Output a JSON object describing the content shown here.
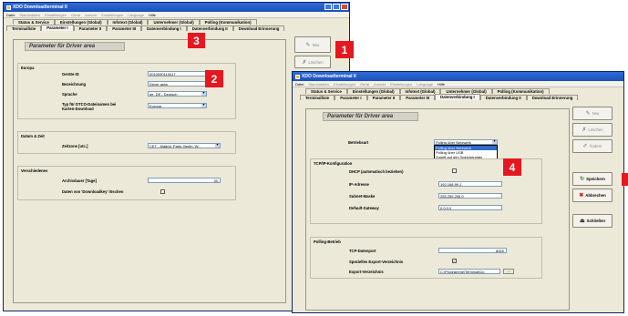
{
  "back_window": {
    "title": "XDO Downloadterminal II",
    "menu": [
      "Datei",
      "Stammdaten",
      "Einstellungen",
      "Gerät",
      "Ansicht",
      "Einstellungen",
      "Language",
      "Hilfe"
    ],
    "tabs_row1": [
      "Status & Service",
      "Einstellungen (Global)",
      "Infotext (Global)",
      "Unternehmer (Global)",
      "Polling (Kommunikation)"
    ],
    "tabs_row2": [
      "Terminalliste",
      "Parameter I",
      "Parameter II",
      "Parameter III",
      "Datenverbindung I",
      "Datenverbindung II",
      "Download Erinnerung"
    ],
    "section_title": "Parameter für  Driver area",
    "europe": {
      "title": "Europa",
      "device_id_label": "Geräte ID",
      "device_id_value": "0010090110017",
      "name_label": "Bezeichnung",
      "name_value": "Driver area",
      "language_label": "Sprache",
      "language_value": "de_DE - Deutsch",
      "type_label": "Typ für DTCO-Dateinamen bei Karten-Download",
      "type_value": "Europa"
    },
    "datetime": {
      "title": "Datum & Zeit",
      "timezone_label": "Zeitzone [utc.]",
      "timezone_value": "CET - Madrid, Paris, Berlin, W..."
    },
    "misc": {
      "title": "Verschiedenes",
      "archive_label": "Archivdauer [Tage]",
      "archive_value": "30",
      "search_label": "Daten von 'Downloadkey' löschen"
    },
    "buttons": {
      "new": "Neu",
      "delete": "Löschen"
    }
  },
  "front_window": {
    "title": "XDO Downloadterminal II",
    "menu": [
      "Datei",
      "Stammdaten",
      "Einstellungen",
      "Gerät",
      "Ansicht",
      "Einstellungen",
      "Language",
      "Hilfe"
    ],
    "tabs_row1": [
      "Status & Service",
      "Einstellungen (Global)",
      "Infotext (Global)",
      "Unternehmer (Global)",
      "Polling (Kommunikation)"
    ],
    "tabs_row2": [
      "Terminalliste",
      "Parameter I",
      "Parameter II",
      "Parameter III",
      "Datenverbindung I",
      "Datenverbindung II",
      "Download Erinnerung"
    ],
    "section_title": "Parameter für  Driver area",
    "mode_label": "Betriebsart",
    "mode_value": "Polling über Netzwerk",
    "mode_options": [
      "Polling über Netzwerk",
      "Polling über USB",
      "Zugriff auf den Speicherplatz",
      "Stand Alone über USB Stick"
    ],
    "tcpip": {
      "title": "TCP/IP-Konfiguration",
      "dhcp_label": "DHCP (automatisch beziehen)",
      "ip_label": "IP-Adresse",
      "ip_value": "192.168.99.1",
      "subnet_label": "Subnet-Maske",
      "subnet_value": "255.255.255.0",
      "gateway_label": "Default-Gateway",
      "gateway_value": "0.0.0.0"
    },
    "polling": {
      "title": "Polling-Betrieb",
      "port_label": "TCP-Datenport",
      "port_value": "8000",
      "export_label": "Spezielles Export-Verzeichnis",
      "export_dir_label": "Export-Verzeichnis",
      "export_dir_value": "C:\\Programme\\Terminal\\Do",
      "browse": "..."
    },
    "buttons": {
      "new": "Neu",
      "delete": "Löschen",
      "change": "Ändern",
      "save": "Speichern",
      "cancel": "Abbrechen",
      "close": "Schließen"
    }
  },
  "callouts": [
    "1",
    "2",
    "3",
    "4"
  ]
}
